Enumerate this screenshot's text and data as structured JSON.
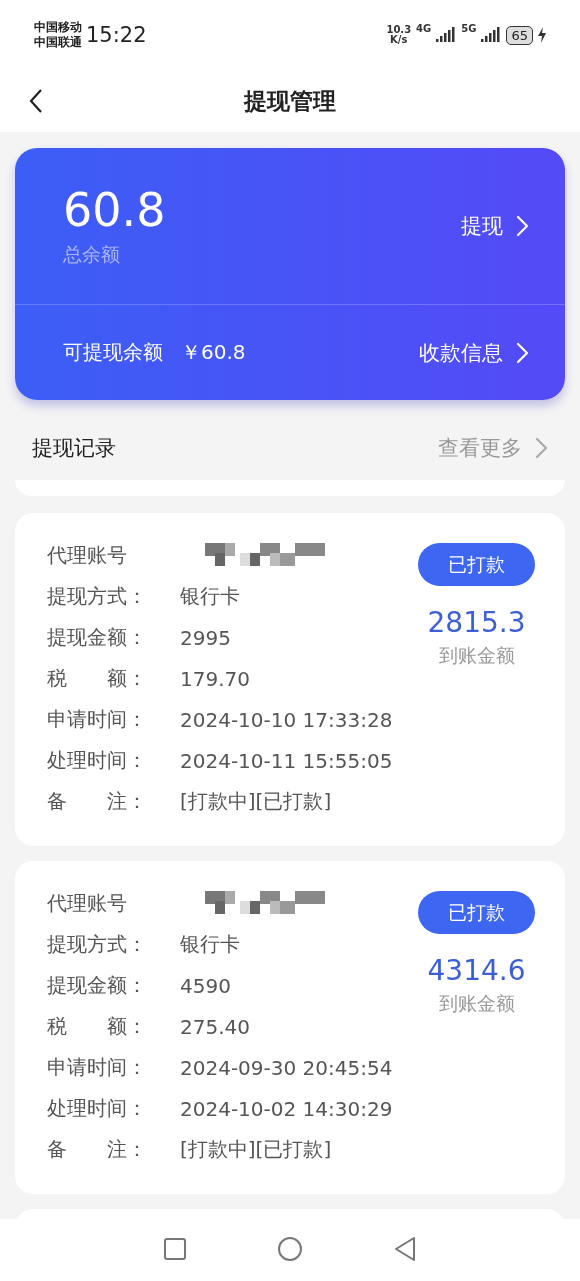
{
  "status_bar": {
    "carriers": [
      "中国移动",
      "中国联通"
    ],
    "time": "15:22",
    "speed": "10.3",
    "speed_unit": "K/s",
    "networks": [
      "4G",
      "5G"
    ],
    "battery": "65"
  },
  "header": {
    "title": "提现管理"
  },
  "balance_card": {
    "amount": "60.8",
    "amount_label": "总余额",
    "withdraw": "提现",
    "available_label": "可提现余额",
    "available_value": "￥60.8",
    "payee_info": "收款信息"
  },
  "records_section": {
    "title": "提现记录",
    "more": "查看更多"
  },
  "records": [
    {
      "account_label": "代理账号",
      "status": "已打款",
      "received": "2815.3",
      "received_label": "到账金额",
      "fields": [
        {
          "label": "提现方式：",
          "value": "银行卡"
        },
        {
          "label": "提现金额：",
          "value": "2995"
        },
        {
          "label": "税　　额：",
          "value": "179.70"
        },
        {
          "label": "申请时间：",
          "value": "2024-10-10 17:33:28"
        },
        {
          "label": "处理时间：",
          "value": "2024-10-11 15:55:05"
        },
        {
          "label": "备　　注：",
          "value": "[打款中][已打款]"
        }
      ]
    },
    {
      "account_label": "代理账号",
      "status": "已打款",
      "received": "4314.6",
      "received_label": "到账金额",
      "fields": [
        {
          "label": "提现方式：",
          "value": "银行卡"
        },
        {
          "label": "提现金额：",
          "value": "4590"
        },
        {
          "label": "税　　额：",
          "value": "275.40"
        },
        {
          "label": "申请时间：",
          "value": "2024-09-30 20:45:54"
        },
        {
          "label": "处理时间：",
          "value": "2024-10-02 14:30:29"
        },
        {
          "label": "备　　注：",
          "value": "[打款中][已打款]"
        }
      ]
    }
  ]
}
